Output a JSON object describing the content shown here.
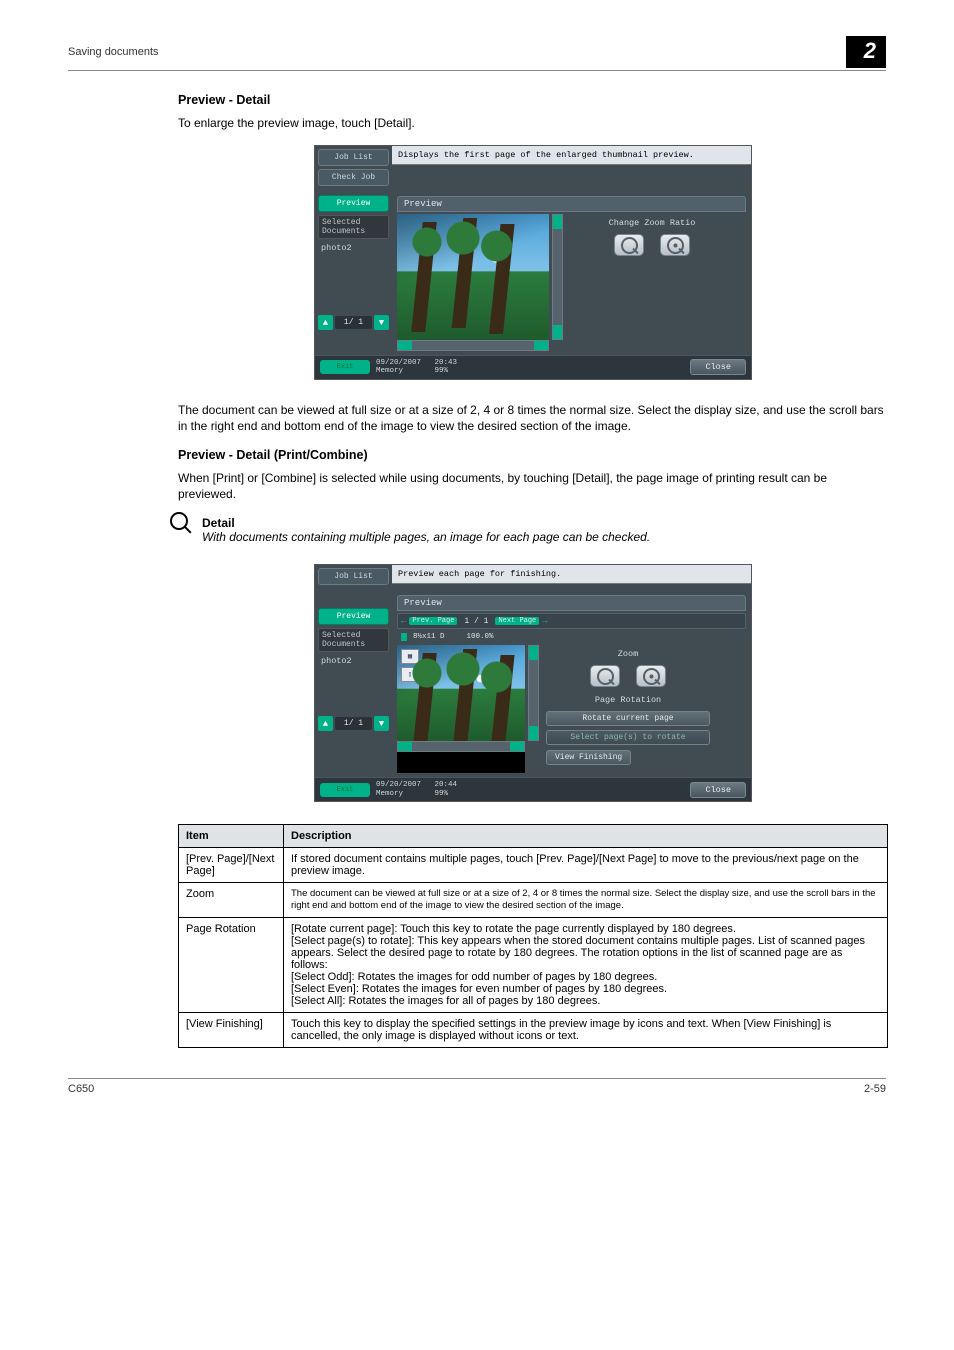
{
  "header": {
    "breadcrumb": "Saving documents",
    "chapter": "2"
  },
  "sec1": {
    "title": "Preview - Detail",
    "intro": "To enlarge the preview image, touch [Detail].",
    "after": "The document can be viewed at full size or at a size of 2, 4 or 8 times the normal size. Select the display size, and use the scroll bars in the right end and bottom end of the image to view the desired section of the image."
  },
  "ui1": {
    "job_list": "Job List",
    "check_job": "Check Job",
    "preview": "Preview",
    "selected_docs": "Selected Documents",
    "doc_name": "photo2",
    "pager": "1/  1",
    "banner": "Displays the first page of the enlarged thumbnail preview.",
    "panel_title": "Preview",
    "zoom_label": "Change Zoom Ratio",
    "exit_label": "Exit",
    "date": "09/20/2007",
    "time": "20:43",
    "mem_label": "Memory",
    "mem_val": "99%",
    "close": "Close"
  },
  "sec2": {
    "title": "Preview - Detail (Print/Combine)",
    "intro": "When [Print] or [Combine] is selected while using documents, by touching [Detail], the page image of printing result can be previewed."
  },
  "note": {
    "heading": "Detail",
    "body": "With documents containing multiple pages, an image for each page can be checked."
  },
  "ui2": {
    "job_list": "Job List",
    "preview": "Preview",
    "selected_docs": "Selected Documents",
    "doc_name": "photo2",
    "pager": "1/  1",
    "banner": "Preview each page for finishing.",
    "panel_title": "Preview",
    "prev_page": "Prev. Page",
    "next_page": "Next Page",
    "page_text": "1 /     1",
    "size_text": "8½x11 D",
    "zoom_pct": "100.0%",
    "zoom_label": "Zoom",
    "rotation_label": "Page Rotation",
    "rotate_current": "Rotate current page",
    "select_pages": "Select page(s) to rotate",
    "view_finishing": "View Finishing",
    "exit_label": "Exit",
    "date": "09/20/2007",
    "time": "20:44",
    "mem_label": "Memory",
    "mem_val": "99%",
    "close": "Close"
  },
  "table": {
    "h1": "Item",
    "h2": "Description",
    "rows": [
      {
        "item": "[Prev. Page]/[Next Page]",
        "desc": "If stored document contains multiple pages, touch [Prev. Page]/[Next Page] to move to the previous/next page on the preview image."
      },
      {
        "item": "Zoom",
        "desc_tiny": "The document can be viewed at full size or at a size of 2, 4 or 8 times the normal size. Select the display size, and use the scroll bars in the right end and bottom end of the image to view the desired section of the image."
      },
      {
        "item": "Page Rotation",
        "desc": "[Rotate current page]: Touch this key to rotate the page currently displayed by 180 degrees.\n[Select page(s) to rotate]: This key appears when the stored document contains multiple pages. List of scanned pages appears. Select the desired page to rotate by 180 degrees. The rotation options in the list of scanned page are as follows:\n[Select Odd]: Rotates the images for odd number of pages by 180 degrees.\n[Select Even]: Rotates the images for even number of pages by 180 degrees.\n[Select All]: Rotates the images for all of pages by 180 degrees."
      },
      {
        "item": "[View Finishing]",
        "desc": "Touch this key to display the specified settings in the preview image by icons and text. When [View Finishing] is cancelled, the only image is displayed without icons or text."
      }
    ]
  },
  "footer": {
    "left": "C650",
    "right": "2-59"
  }
}
